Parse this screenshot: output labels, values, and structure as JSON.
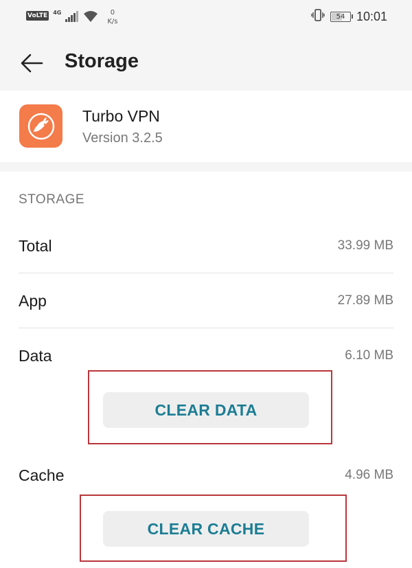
{
  "status_bar": {
    "volte": "VoLTE",
    "network": "4G",
    "speed_value": "0",
    "speed_unit": "K/s",
    "battery_level": "54",
    "time": "10:01",
    "icons": [
      "signal-icon",
      "wifi-icon",
      "vibrate-icon",
      "battery-icon"
    ]
  },
  "app_bar": {
    "title": "Storage",
    "back_icon": "back-arrow-icon"
  },
  "app_info": {
    "name": "Turbo VPN",
    "version": "Version 3.2.5",
    "icon": "turbo-vpn-rabbit-icon",
    "icon_color": "#f47b4a"
  },
  "storage": {
    "section_title": "STORAGE",
    "rows": [
      {
        "label": "Total",
        "value": "33.99 MB"
      },
      {
        "label": "App",
        "value": "27.89 MB"
      },
      {
        "label": "Data",
        "value": "6.10 MB"
      },
      {
        "label": "Cache",
        "value": "4.96 MB"
      }
    ],
    "clear_data_label": "CLEAR DATA",
    "clear_cache_label": "CLEAR CACHE"
  },
  "colors": {
    "accent": "#1b7d94",
    "highlight_box": "#b8363b",
    "background": "#f5f5f5"
  }
}
